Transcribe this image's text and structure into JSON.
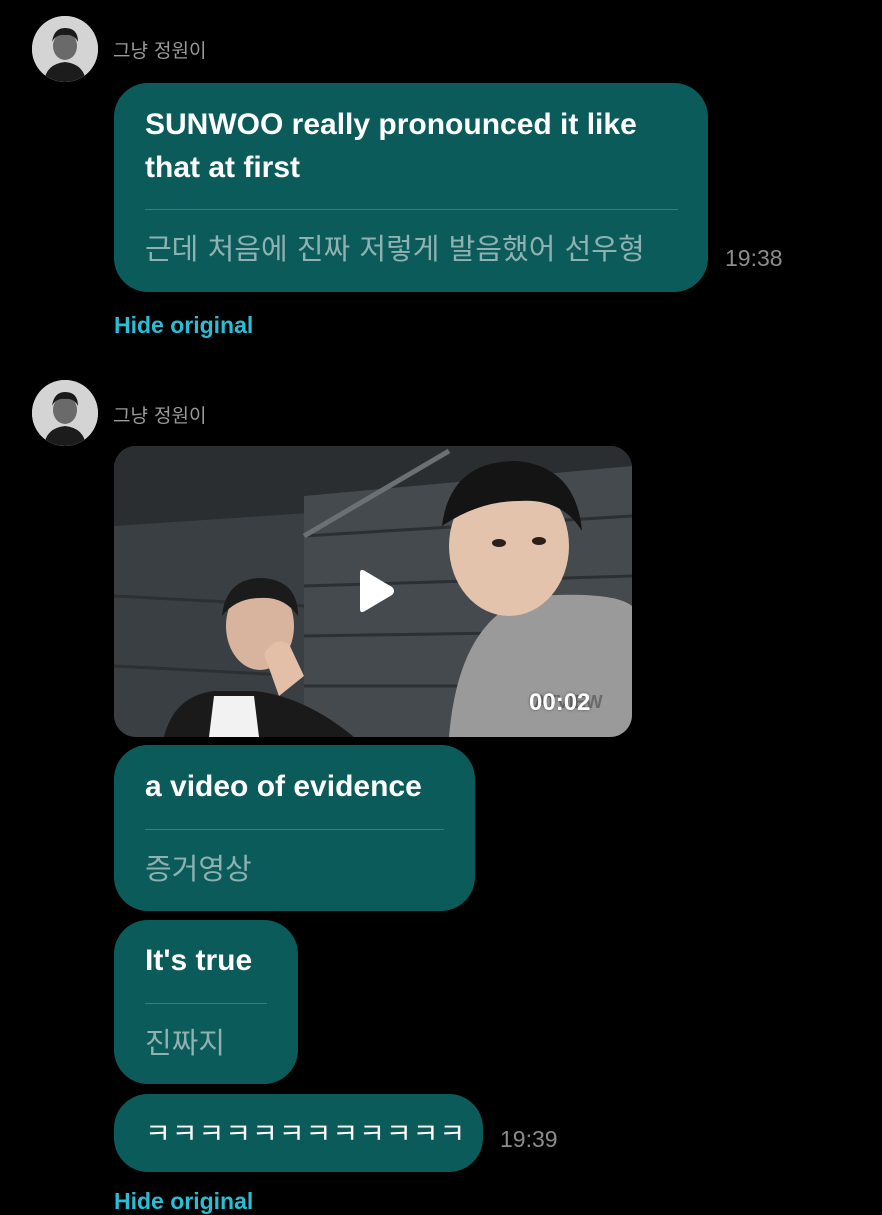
{
  "colors": {
    "background": "#000000",
    "bubble": "#0b5b5b",
    "link": "#28bfd6",
    "muted": "#8c8c8c"
  },
  "messages": [
    {
      "sender": "그냥 정원이",
      "translated": "SUNWOO really pronounced it like that at first",
      "original": "근데 처음에 진짜 저렇게 발음했어 선우형",
      "time": "19:38",
      "hide_label": "Hide original"
    },
    {
      "sender": "그냥 정원이",
      "video": {
        "duration": "00:02",
        "icon": "play-icon"
      },
      "bubbles": [
        {
          "translated": "a video of evidence",
          "original": "증거영상"
        },
        {
          "translated": "It's true",
          "original": "진짜지"
        },
        {
          "text": "ㅋㅋㅋㅋㅋㅋㅋㅋㅋㅋㅋㅋ"
        }
      ],
      "time": "19:39",
      "hide_label": "Hide original"
    }
  ],
  "avatar_icon": "profile-avatar"
}
